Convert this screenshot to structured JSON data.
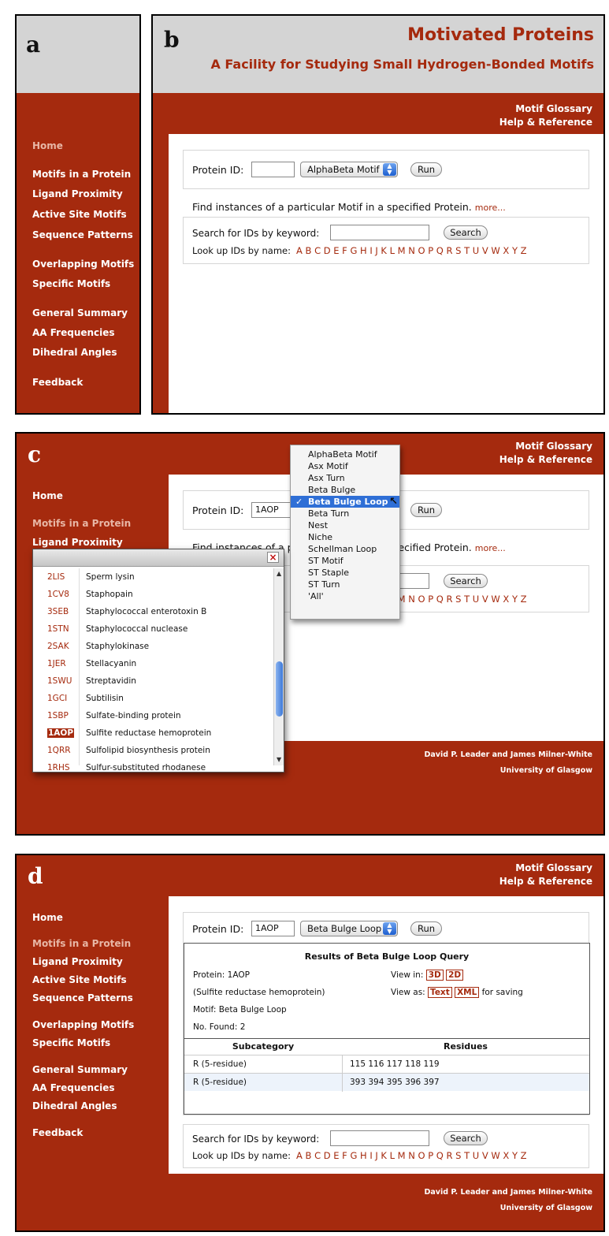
{
  "panels": {
    "a": "a",
    "b": "b",
    "c": "c",
    "d": "d"
  },
  "site": {
    "title": "Motivated Proteins",
    "subtitle": "A Facility for Studying Small Hydrogen-Bonded Motifs",
    "top_links": [
      "Motif Glossary",
      "Help & Reference"
    ]
  },
  "nav": {
    "home": "Home",
    "motifs_in_protein": "Motifs in a Protein",
    "ligand_proximity": "Ligand Proximity",
    "active_site_motifs": "Active Site Motifs",
    "sequence_patterns": "Sequence Patterns",
    "overlapping_motifs": "Overlapping Motifs",
    "specific_motifs": "Specific Motifs",
    "general_summary": "General Summary",
    "aa_frequencies": "AA Frequencies",
    "dihedral_angles": "Dihedral Angles",
    "feedback": "Feedback"
  },
  "form": {
    "protein_id_label": "Protein ID:",
    "protein_id_value_b": "",
    "protein_id_value_cd": "1AOP",
    "motif_selected_b": "AlphaBeta Motif",
    "motif_selected_c": "Beta Bulge Loop",
    "motif_selected_d": "Beta Bulge Loop",
    "run_label": "Run",
    "find_text": "Find instances of a particular Motif in a specified Protein.",
    "more_link": "more...",
    "search_label": "Search for IDs by keyword:",
    "search_button": "Search",
    "lookup_label": "Look up IDs by name:",
    "letters": "A B C D E F G H I J K L M N O P Q R S T U V W X Y Z"
  },
  "dropdown": {
    "options": [
      "AlphaBeta Motif",
      "Asx Motif",
      "Asx Turn",
      "Beta Bulge",
      "Beta Bulge Loop",
      "Beta Turn",
      "Nest",
      "Niche",
      "Schellman Loop",
      "ST Motif",
      "ST Staple",
      "ST Turn",
      "'All'"
    ],
    "selected_index": 4,
    "check": "✓"
  },
  "popup": {
    "close": "×",
    "rows": [
      {
        "id": "2LIS",
        "name": "Sperm lysin"
      },
      {
        "id": "1CV8",
        "name": "Staphopain"
      },
      {
        "id": "3SEB",
        "name": "Staphylococcal enterotoxin B"
      },
      {
        "id": "1STN",
        "name": "Staphylococcal nuclease"
      },
      {
        "id": "2SAK",
        "name": "Staphylokinase"
      },
      {
        "id": "1JER",
        "name": "Stellacyanin"
      },
      {
        "id": "1SWU",
        "name": "Streptavidin"
      },
      {
        "id": "1GCI",
        "name": "Subtilisin"
      },
      {
        "id": "1SBP",
        "name": "Sulfate-binding protein"
      },
      {
        "id": "1AOP",
        "name": "Sulfite reductase hemoprotein"
      },
      {
        "id": "1QRR",
        "name": "Sulfolipid biosynthesis protein"
      },
      {
        "id": "1RHS",
        "name": "Sulfur-substituted rhodanese"
      }
    ],
    "highlighted_index": 9
  },
  "results": {
    "title": "Results of Beta Bulge Loop Query",
    "protein": "Protein: 1AOP",
    "protein_name": "(Sulfite reductase hemoprotein)",
    "motif": "Motif: Beta Bulge Loop",
    "found": "No. Found: 2",
    "view_in": "View in:",
    "view_3d": "3D",
    "view_2d": "2D",
    "view_as": "View as:",
    "as_text": "Text",
    "as_xml": "XML",
    "for_saving": "for saving",
    "col_sub": "Subcategory",
    "col_res": "Residues",
    "rows": [
      {
        "sub": "R (5-residue)",
        "res": "115 116 117 118 119"
      },
      {
        "sub": "R (5-residue)",
        "res": "393 394 395 396 397"
      }
    ]
  },
  "footer": {
    "authors": "David P. Leader and James Milner-White",
    "uni": "University of Glasgow"
  },
  "colors": {
    "accent": "#a52a0e",
    "header_grey": "#d4d4d4",
    "select_blue": "#2f6fd6"
  }
}
